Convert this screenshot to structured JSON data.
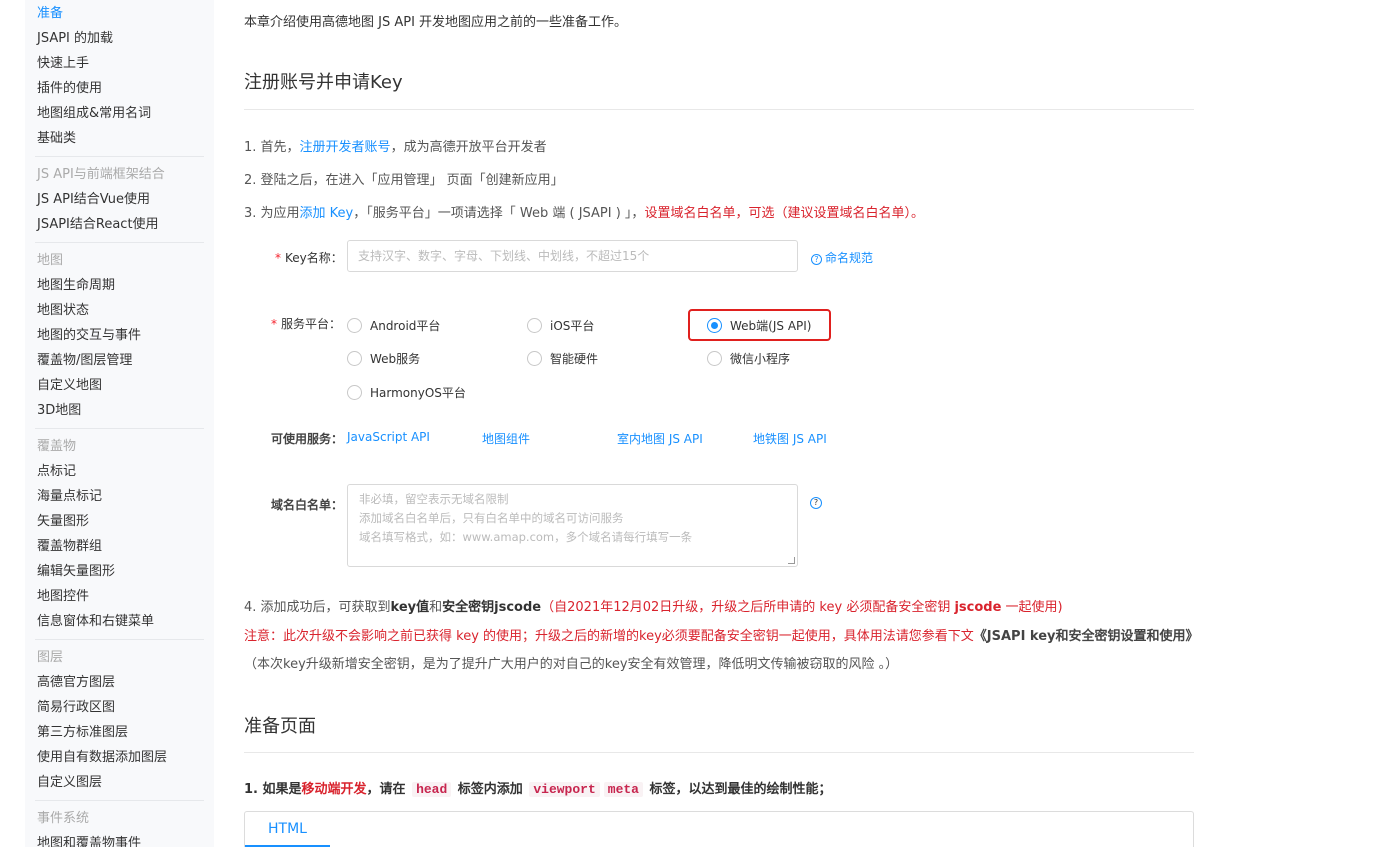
{
  "sidebar": {
    "top_items": [
      {
        "label": "准备",
        "active": true
      },
      {
        "label": "JSAPI 的加载"
      },
      {
        "label": "快速上手"
      },
      {
        "label": "插件的使用"
      },
      {
        "label": "地图组成&常用名词"
      },
      {
        "label": "基础类"
      }
    ],
    "groups": [
      {
        "title": "JS API与前端框架结合",
        "items": [
          "JS API结合Vue使用",
          "JSAPI结合React使用"
        ]
      },
      {
        "title": "地图",
        "items": [
          "地图生命周期",
          "地图状态",
          "地图的交互与事件",
          "覆盖物/图层管理",
          "自定义地图",
          "3D地图"
        ]
      },
      {
        "title": "覆盖物",
        "items": [
          "点标记",
          "海量点标记",
          "矢量图形",
          "覆盖物群组",
          "编辑矢量图形",
          "地图控件",
          "信息窗体和右键菜单"
        ]
      },
      {
        "title": "图层",
        "items": [
          "高德官方图层",
          "简易行政区图",
          "第三方标准图层",
          "使用自有数据添加图层",
          "自定义图层"
        ]
      },
      {
        "title": "事件系统",
        "items": [
          "地图和覆盖物事件"
        ]
      }
    ]
  },
  "main": {
    "intro": "本章介绍使用高德地图 JS API 开发地图应用之前的一些准备工作。",
    "section1_title": "注册账号并申请Key",
    "step1": {
      "prefix": "1. 首先，",
      "link": "注册开发者账号",
      "suffix": "，成为高德开放平台开发者"
    },
    "step2": "2. 登陆之后，在进入「应用管理」 页面「创建新应用」",
    "step3": {
      "prefix": "3. 为应用",
      "link": "添加 Key",
      "middle": "，「服务平台」一项请选择「 Web 端 ( JSAPI ) 」，",
      "red": "设置域名白名单，可选（建议设置域名白名单）。"
    },
    "form": {
      "key_name_label": "Key名称：",
      "key_name_placeholder": "支持汉字、数字、字母、下划线、中划线，不超过15个",
      "naming_rule_link": "命名规范",
      "platform_label": "服务平台：",
      "platforms": [
        "Android平台",
        "iOS平台",
        "Web端(JS API)",
        "Web服务",
        "智能硬件",
        "微信小程序",
        "HarmonyOS平台"
      ],
      "platform_selected": "Web端(JS API)",
      "services_label": "可使用服务：",
      "services": [
        "JavaScript API",
        "地图组件",
        "室内地图 JS API",
        "地铁图 JS API"
      ],
      "domain_label": "域名白名单：",
      "domain_placeholder_lines": [
        "非必填，留空表示无域名限制",
        "添加域名白名单后，只有白名单中的域名可访问服务",
        "域名填写格式，如：www.amap.com，多个域名请每行填写一条"
      ]
    },
    "step4": {
      "prefix": "4. 添加成功后，可获取到",
      "key": "key值",
      "and": "和",
      "jscode": "安全密钥jscode",
      "red1": "（自2021年12月02日升级，升级之后所申请的 key 必须配备安全密钥 ",
      "red_bold": "jscode",
      "red2": " 一起使用)"
    },
    "note": {
      "red": "注意：此次升级不会影响之前已获得 key 的使用；升级之后的新增的key必须要配备安全密钥一起使用，具体用法请您参看下文",
      "bold": "《JSAPI key和安全密钥设置和使用》",
      "gray": "（本次key升级新增安全密钥，是为了提升广大用户的对自己的key安全有效管理，降低明文传输被窃取的风险 。）"
    },
    "section2_title": "准备页面",
    "prep": {
      "p1": "1. 如果是",
      "red": "移动端开发",
      "p2": "，请在 ",
      "code1": "head",
      "p3": " 标签内添加 ",
      "code2": "viewport",
      "code3": "meta",
      "p4": " 标签，以达到最佳的绘制性能；"
    },
    "code_tab": "HTML"
  }
}
